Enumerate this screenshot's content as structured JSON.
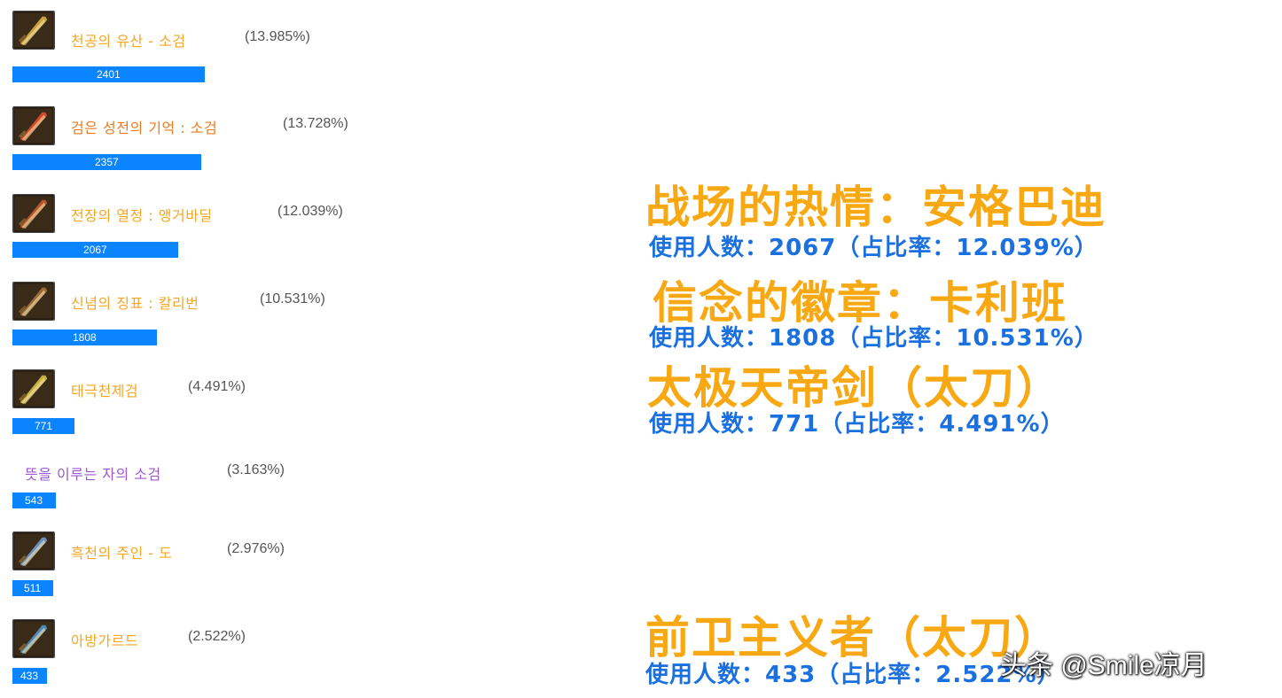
{
  "items": [
    {
      "name": "천공의 유산 - 소검",
      "percent": "(13.985%)",
      "count": "2401",
      "share": 0.13985,
      "name_color": "#f5a623",
      "has_icon": true,
      "icon_hue": "#c9a03a",
      "bar_fraction": 0.1513
    },
    {
      "name": "검은 성전의 기억 : 소검",
      "percent": "(13.728%)",
      "count": "2357",
      "share": 0.13728,
      "name_color": "#e97b1f",
      "has_icon": true,
      "icon_hue": "#d0462a",
      "bar_fraction": 0.1485
    },
    {
      "name": "전장의 열정 : 앵거바딜",
      "percent": "(12.039%)",
      "count": "2067",
      "share": 0.12039,
      "name_color": "#f5a623",
      "has_icon": true,
      "icon_hue": "#b8552b",
      "bar_fraction": 0.1303
    },
    {
      "name": "신념의 징표 : 칼리번",
      "percent": "(10.531%)",
      "count": "1808",
      "share": 0.10531,
      "name_color": "#f5a623",
      "has_icon": true,
      "icon_hue": "#9a6a3a",
      "bar_fraction": 0.1139
    },
    {
      "name": "태극천제검",
      "percent": "(4.491%)",
      "count": "771",
      "share": 0.04491,
      "name_color": "#f5a623",
      "has_icon": true,
      "icon_hue": "#c8b040",
      "bar_fraction": 0.0487
    },
    {
      "name": "뜻을 이루는 자의 소검",
      "percent": "(3.163%)",
      "count": "543",
      "share": 0.03163,
      "name_color": "#9b59d0",
      "has_icon": false,
      "icon_hue": "",
      "bar_fraction": 0.0342
    },
    {
      "name": "흑천의 주인 - 도",
      "percent": "(2.976%)",
      "count": "511",
      "share": 0.02976,
      "name_color": "#f5a623",
      "has_icon": true,
      "icon_hue": "#6a8fc0",
      "bar_fraction": 0.0322
    },
    {
      "name": "아방가르드",
      "percent": "(2.522%)",
      "count": "433",
      "share": 0.02522,
      "name_color": "#f5a623",
      "has_icon": true,
      "icon_hue": "#4d88b8",
      "bar_fraction": 0.0273
    }
  ],
  "overlays": [
    {
      "title": "战场的热情：安格巴迪",
      "subtitle": "使用人数：2067（占比率：12.039%）"
    },
    {
      "title": "信念的徽章：卡利班",
      "subtitle": "使用人数：1808（占比率：10.531%）"
    },
    {
      "title": "太极天帝剑（太刀）",
      "subtitle": "使用人数：771（占比率：4.491%）"
    },
    {
      "title": "前卫主义者（太刀）",
      "subtitle": "使用人数：433（占比率：2.522%）"
    }
  ],
  "watermark": "头条 @Smile凉月",
  "colors": {
    "bar_fill": "#0a84ff",
    "bar_track": "#e6e8eb",
    "overlay_title": "#f8a813",
    "overlay_subtitle": "#1b70e0"
  }
}
